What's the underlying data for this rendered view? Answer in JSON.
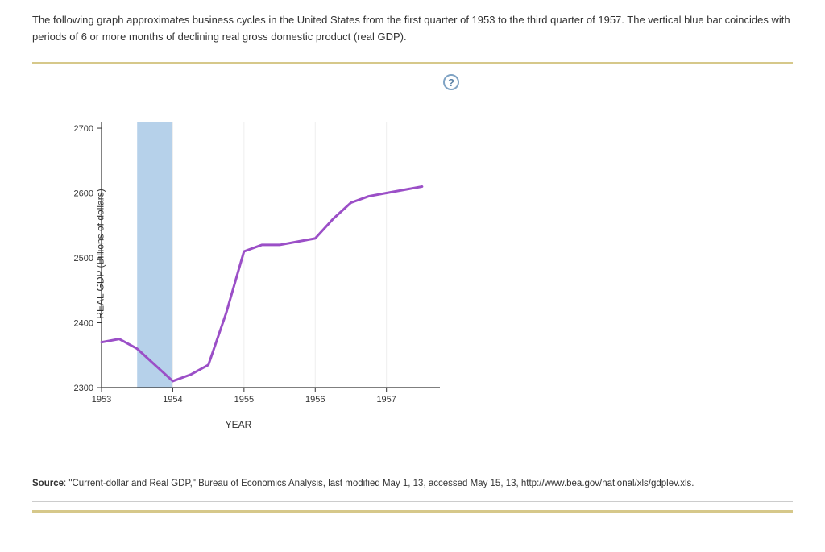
{
  "intro_text": "The following graph approximates business cycles in the United States from the first quarter of 1953 to the third quarter of 1957. The vertical blue bar coincides with periods of 6 or more months of declining real gross domestic product (real GDP).",
  "help_label": "?",
  "chart_data": {
    "type": "line",
    "xlabel": "YEAR",
    "ylabel": "REAL GDP (Billions of dollars)",
    "x_ticks": [
      1953,
      1954,
      1955,
      1956,
      1957
    ],
    "y_ticks": [
      2300,
      2400,
      2500,
      2600,
      2700
    ],
    "xlim": [
      1953,
      1957.75
    ],
    "ylim": [
      2300,
      2710
    ],
    "series": [
      {
        "name": "Real GDP",
        "color": "#9b4fc7",
        "x": [
          1953.0,
          1953.25,
          1953.5,
          1953.75,
          1954.0,
          1954.25,
          1954.5,
          1954.75,
          1955.0,
          1955.25,
          1955.5,
          1955.75,
          1956.0,
          1956.25,
          1956.5,
          1956.75,
          1957.0,
          1957.25,
          1957.5
        ],
        "values": [
          2370,
          2375,
          2360,
          2335,
          2310,
          2320,
          2335,
          2415,
          2510,
          2520,
          2520,
          2525,
          2530,
          2560,
          2585,
          2595,
          2600,
          2605,
          2610
        ]
      }
    ],
    "recession_band": {
      "start": 1953.5,
      "end": 1954.0,
      "color": "#a9c9e6"
    }
  },
  "source_prefix": "Source",
  "source_text": ": \"Current-dollar and Real GDP,\" Bureau of Economics Analysis, last modified May 1, 13, accessed May 15, 13, http://www.bea.gov/national/xls/gdplev.xls."
}
